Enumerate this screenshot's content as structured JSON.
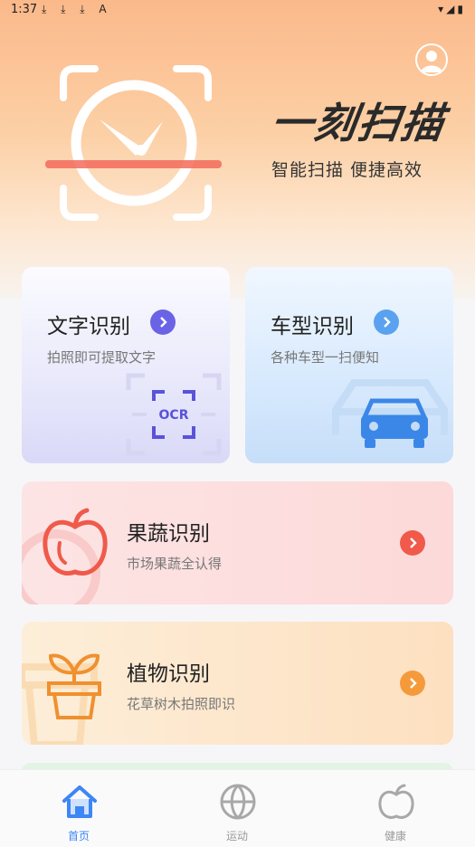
{
  "status_bar": {
    "time": "1:37",
    "notifications": "⤓ ⤓ ⤓ A",
    "indicators": "▾◢▮"
  },
  "brand": {
    "title": "一刻扫描",
    "subtitle": "智能扫描  便捷高效"
  },
  "cards": [
    {
      "title": "文字识别",
      "desc": "拍照即可提取文字",
      "accent": "#6b63e6",
      "badge": "OCR"
    },
    {
      "title": "车型识别",
      "desc": "各种车型一扫便知",
      "accent": "#5aa2f0"
    },
    {
      "title": "果蔬识别",
      "desc": "市场果蔬全认得",
      "accent": "#f05a4a"
    },
    {
      "title": "植物识别",
      "desc": "花草树木拍照即识",
      "accent": "#f59a3b"
    }
  ],
  "nav": {
    "items": [
      {
        "label": "首页",
        "icon": "home-icon",
        "active": true
      },
      {
        "label": "运动",
        "icon": "ball-icon",
        "active": false
      },
      {
        "label": "健康",
        "icon": "apple-icon",
        "active": false
      }
    ]
  },
  "colors": {
    "nav_active": "#3d86f5",
    "nav_inactive": "#9a9a9a"
  }
}
